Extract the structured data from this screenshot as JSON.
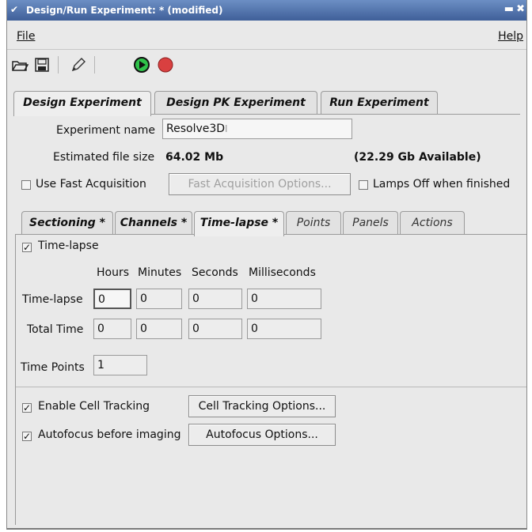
{
  "window": {
    "title": "Design/Run Experiment:  * (modified)"
  },
  "menu": {
    "file": "File",
    "help": "Help"
  },
  "toolbar": {
    "icons": [
      "open-folder-icon",
      "save-disk-icon",
      "edit-pencil-icon",
      "run-play-icon",
      "record-stop-icon"
    ]
  },
  "tabs_top": [
    {
      "label": "Design Experiment",
      "active": true
    },
    {
      "label": "Design PK Experiment",
      "active": false
    },
    {
      "label": "Run Experiment",
      "active": false
    }
  ],
  "design": {
    "experiment_name_label": "Experiment name",
    "experiment_name_value": "Resolve3D",
    "file_size_label": "Estimated file size",
    "file_size_value": "64.02 Mb",
    "available": "(22.29 Gb Available)",
    "use_fast_acquisition": "Use Fast Acquisition",
    "fast_acquisition_options": "Fast Acquisition Options...",
    "lamps_off": "Lamps Off when finished"
  },
  "tabs_sub": [
    {
      "label": "Sectioning *",
      "active": false,
      "light": false
    },
    {
      "label": "Channels *",
      "active": false,
      "light": false
    },
    {
      "label": "Time-lapse *",
      "active": true,
      "light": false
    },
    {
      "label": "Points",
      "active": false,
      "light": true
    },
    {
      "label": "Panels",
      "active": false,
      "light": true
    },
    {
      "label": "Actions",
      "active": false,
      "light": true
    }
  ],
  "timelapse": {
    "enabled_label": "Time-lapse",
    "enabled": true,
    "col_headers": [
      "Hours",
      "Minutes",
      "Seconds",
      "Milliseconds"
    ],
    "row_timelapse_label": "Time-lapse",
    "row_timelapse_values": [
      "0",
      "0",
      "0",
      "0"
    ],
    "row_total_label": "Total Time",
    "row_total_values": [
      "0",
      "0",
      "0",
      "0"
    ],
    "time_points_label": "Time Points",
    "time_points_value": "1",
    "enable_cell_tracking": "Enable Cell Tracking",
    "cell_tracking_options": "Cell Tracking Options...",
    "autofocus_before": "Autofocus before imaging",
    "autofocus_options": "Autofocus Options..."
  }
}
